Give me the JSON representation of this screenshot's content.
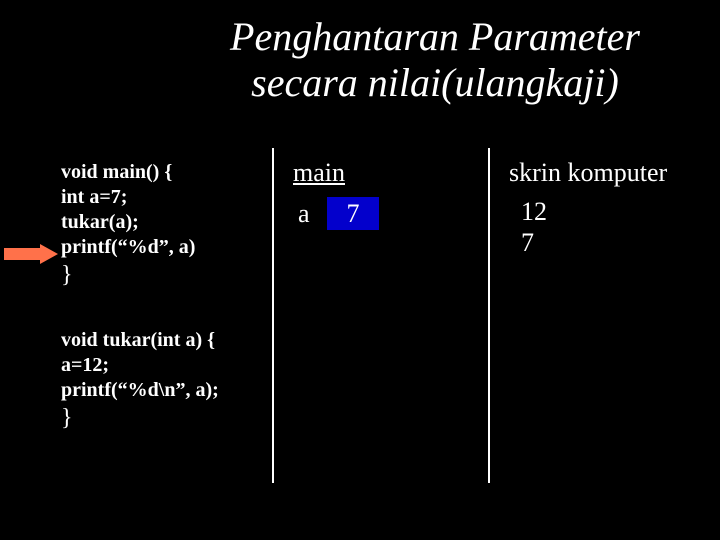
{
  "title_line1": "Penghantaran Parameter",
  "title_line2": "secara nilai(ulangkaji)",
  "code_main": {
    "l1": "void main() {",
    "l2": "int a=7;",
    "l3": "tukar(a);",
    "l4": "printf(“%d”, a)",
    "l5": "}"
  },
  "code_tukar": {
    "l1": "void tukar(int a) {",
    "l2": "a=12;",
    "l3": "printf(“%d\\n”, a);",
    "l4": "}"
  },
  "col2": {
    "header": "main",
    "var_label": "a",
    "var_value": "7"
  },
  "col3": {
    "header": "skrin komputer",
    "line1": "12",
    "line2": "7"
  },
  "colors": {
    "value_box_bg": "#0300cc",
    "arrow_fill": "#ff714a"
  }
}
